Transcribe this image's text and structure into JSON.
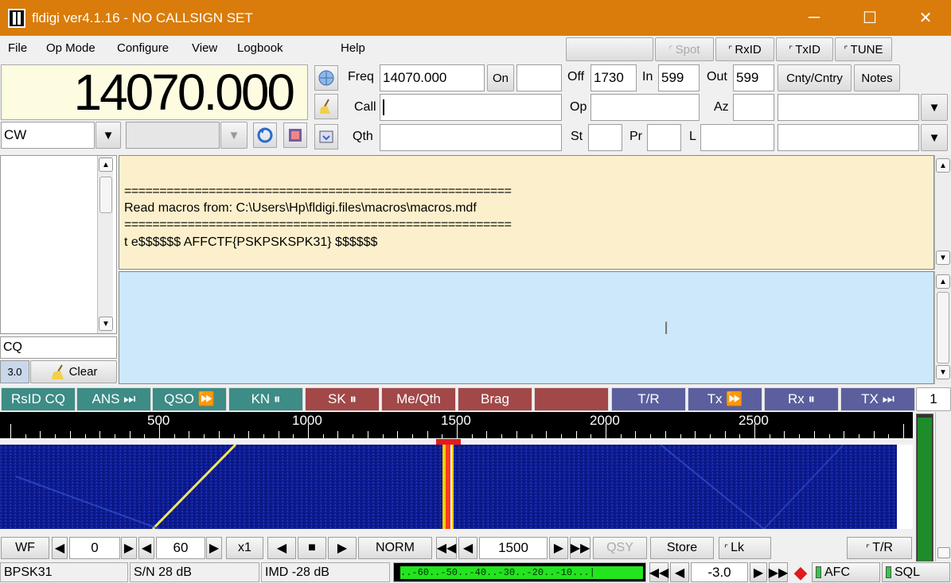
{
  "window": {
    "title": "fldigi ver4.1.16 - NO CALLSIGN SET",
    "minimize": "─",
    "maximize": "☐",
    "close": "✕"
  },
  "menu": {
    "file": "File",
    "opmode": "Op Mode",
    "configure": "Configure",
    "view": "View",
    "logbook": "Logbook",
    "help": "Help"
  },
  "topbuttons": {
    "spot": "Spot",
    "rxid": "RxID",
    "txid": "TxID",
    "tune": "TUNE"
  },
  "frequency_display": "14070.000",
  "mode": {
    "value": "CW",
    "bandwidth": ""
  },
  "log": {
    "freq_label": "Freq",
    "freq_value": "14070.000",
    "on_label": "On",
    "on_value": "",
    "off_label": "Off",
    "off_value": "1730",
    "in_label": "In",
    "in_value": "599",
    "out_label": "Out",
    "out_value": "599",
    "cnty_label": "Cnty/Cntry",
    "notes_label": "Notes",
    "call_label": "Call",
    "call_value": "",
    "op_label": "Op",
    "op_value": "",
    "az_label": "Az",
    "az_value": "",
    "qth_label": "Qth",
    "qth_value": "",
    "st_label": "St",
    "st_value": "",
    "pr_label": "Pr",
    "pr_value": "",
    "l_label": "L",
    "l_value": ""
  },
  "rx_text": {
    "line1": "=======================================================",
    "line2": "Read macros from: C:\\Users\\Hp\\fldigi.files\\macros\\macros.mdf",
    "line3": "=======================================================",
    "line4": "t e$$$$$$ AFFCTF{PSKPSKSPK31} $$$$$$"
  },
  "left_panel": {
    "search_value": "CQ",
    "version_badge": "3.0",
    "clear_label": "Clear"
  },
  "macros": [
    {
      "label": "RsID CQ",
      "color": "#3d8c86"
    },
    {
      "label": "ANS ⏭",
      "color": "#3d8c86"
    },
    {
      "label": "QSO ⏩",
      "color": "#3d8c86"
    },
    {
      "label": "KN ⏸",
      "color": "#3d8c86"
    },
    {
      "label": "SK ⏸",
      "color": "#a24848"
    },
    {
      "label": "Me/Qth",
      "color": "#a24848"
    },
    {
      "label": "Brag",
      "color": "#a24848"
    },
    {
      "label": "",
      "color": "#a24848"
    },
    {
      "label": "T/R",
      "color": "#5b5f9e"
    },
    {
      "label": "Tx ⏩",
      "color": "#5b5f9e"
    },
    {
      "label": "Rx ⏸",
      "color": "#5b5f9e"
    },
    {
      "label": "TX ⏭",
      "color": "#5b5f9e"
    }
  ],
  "macro_set": "1",
  "scale_labels": [
    "500",
    "1000",
    "1500",
    "2000",
    "2500"
  ],
  "controls": {
    "wf": "WF",
    "ref_level": "0",
    "range": "60",
    "zoom": "x1",
    "norm": "NORM",
    "carrier": "1500",
    "qsy": "QSY",
    "store": "Store",
    "lk": "Lk",
    "tr": "T/R"
  },
  "status": {
    "mode": "BPSK31",
    "sn": "S/N 28 dB",
    "imd": "IMD -28 dB",
    "meter": "..-60..-50..-40..-30..-20..-10...|",
    "squelch": "-3.0",
    "afc": "AFC",
    "sql": "SQL"
  }
}
